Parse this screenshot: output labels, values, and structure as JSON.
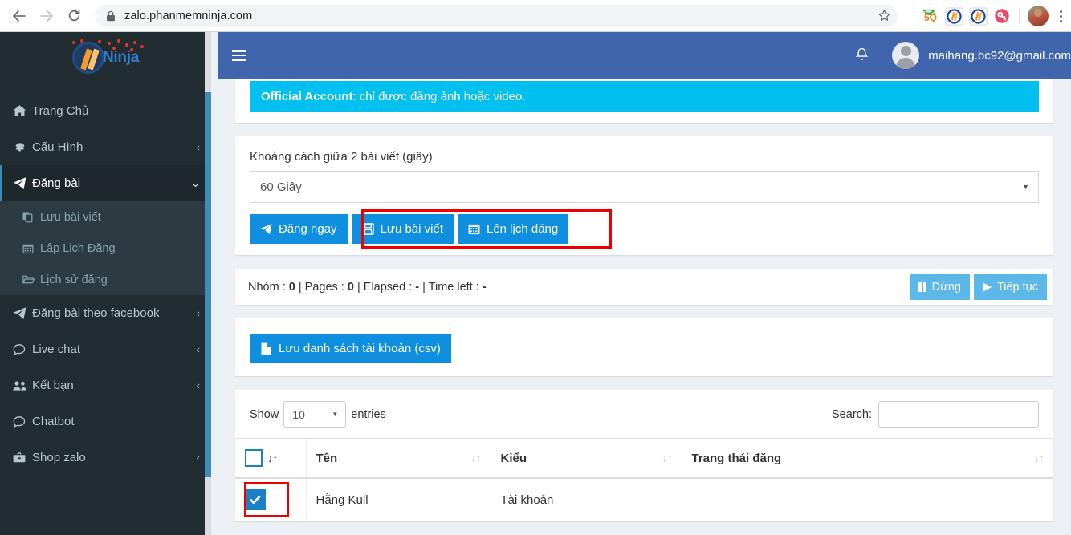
{
  "browser": {
    "back_icon": "back-arrow-icon",
    "forward_icon": "forward-arrow-icon",
    "reload_icon": "reload-icon",
    "lock_icon": "lock-icon",
    "url": "zalo.phanmemninja.com",
    "star_icon": "bookmark-star-icon",
    "extensions": [
      {
        "name": "extension-5q-icon",
        "label": "5Q"
      },
      {
        "name": "extension-ninja-1-icon",
        "label": "N"
      },
      {
        "name": "extension-ninja-2-icon",
        "label": "N"
      },
      {
        "name": "extension-key-icon",
        "label": "key"
      }
    ],
    "profile_avatar": "profile-avatar",
    "menu_icon": "chrome-menu-icon"
  },
  "sidebar": {
    "logo_text": "Ninja",
    "items": [
      {
        "label": "Trang Chủ",
        "icon": "home-icon",
        "arrow": "",
        "active": false
      },
      {
        "label": "Cấu Hình",
        "icon": "gear-icon",
        "arrow": "‹",
        "active": false
      },
      {
        "label": "Đăng bài",
        "icon": "paper-plane-icon",
        "arrow": "⌄",
        "active": true
      }
    ],
    "submenu": [
      {
        "label": "Lưu bài viết",
        "icon": "copy-icon"
      },
      {
        "label": "Lập Lịch Đăng",
        "icon": "calendar-icon"
      },
      {
        "label": "Lịch sử đăng",
        "icon": "folder-open-icon"
      }
    ],
    "items_after": [
      {
        "label": "Đăng bài theo facebook",
        "icon": "paper-plane-icon",
        "arrow": "‹"
      },
      {
        "label": "Live chat",
        "icon": "comment-icon",
        "arrow": "‹"
      },
      {
        "label": "Kết bạn",
        "icon": "users-icon",
        "arrow": "‹"
      },
      {
        "label": "Chatbot",
        "icon": "comment-icon",
        "arrow": ""
      },
      {
        "label": "Shop zalo",
        "icon": "briefcase-icon",
        "arrow": "‹"
      }
    ]
  },
  "topbar": {
    "menu_toggle_icon": "hamburger-icon",
    "bell_icon": "notification-bell-icon",
    "user_email": "maihang.bc92@gmail.com"
  },
  "alert": {
    "strong": "Official Account",
    "text": ": chỉ được đăng ảnh hoặc video."
  },
  "interval": {
    "label": "Khoảng cách giữa 2 bài viết (giây)",
    "selected": "60 Giây"
  },
  "actions": {
    "post_now": "Đăng ngay",
    "save_post": "Lưu bài viết",
    "schedule_post": "Lên lịch đăng"
  },
  "status": {
    "groups_label": "Nhóm : ",
    "groups_value": "0",
    "pages_label": " | Pages : ",
    "pages_value": "0",
    "elapsed_label": " | Elapsed : ",
    "elapsed_value": "-",
    "timeleft_label": " | Time left : ",
    "timeleft_value": "-",
    "pause_label": "Dừng",
    "resume_label": "Tiếp tục"
  },
  "csv": {
    "save_accounts_label": "Lưu danh sách tài khoản (csv)"
  },
  "datatable": {
    "show_label": "Show",
    "entries_label": "entries",
    "page_length": "10",
    "search_label": "Search:",
    "search_value": "",
    "columns": [
      "",
      "Tên",
      "Kiểu",
      "Trang thái đăng"
    ],
    "rows": [
      {
        "checked": true,
        "name": "Hằng Kull",
        "type": "Tài khoản",
        "status": ""
      }
    ]
  },
  "colors": {
    "sidebar_bg": "#222d32",
    "topbar_blue": "#4165ad",
    "primary_blue": "#0e8fe0",
    "info_cyan": "#00c0ef",
    "light_blue": "#5bb8e8",
    "annotation_red": "#ef0000",
    "scrollbar_blue": "#3c8dbc"
  }
}
